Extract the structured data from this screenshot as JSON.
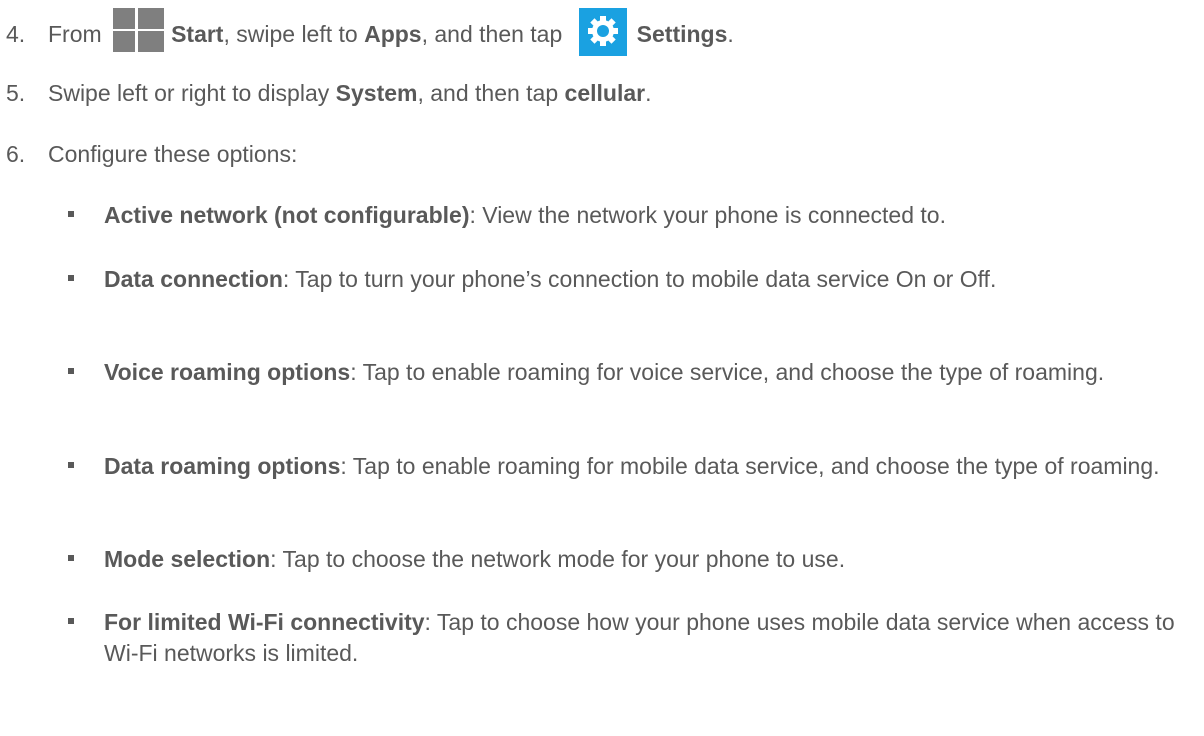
{
  "steps": [
    {
      "number": "4.",
      "p1": "From",
      "p2": "Start",
      "p3": ", swipe left to ",
      "p4": "Apps",
      "p5": ", and then tap",
      "p6": "Settings",
      "p7": "."
    },
    {
      "number": "5.",
      "p1": "Swipe left or right to display ",
      "p2": "System",
      "p3": ", and then tap ",
      "p4": "cellular",
      "p5": "."
    },
    {
      "number": "6.",
      "p1": "Configure these options:"
    }
  ],
  "options": [
    {
      "term": "Active network (not configurable)",
      "desc": ": View the network your phone is connected to."
    },
    {
      "term": "Data connection",
      "desc": ": Tap to turn your phone’s connection to mobile data service On or Off."
    },
    {
      "term": "Voice roaming options",
      "desc": ": Tap to enable roaming for voice service, and choose the type of roaming."
    },
    {
      "term": "Data roaming options",
      "desc": ": Tap to enable roaming for mobile data service, and choose the type of roaming."
    },
    {
      "term": "Mode selection",
      "desc": ": Tap to choose the network mode for your phone to use."
    },
    {
      "term": "For limited Wi-Fi connectivity",
      "desc": ": Tap to choose how your phone uses mobile data service when access to Wi-Fi networks is limited."
    }
  ],
  "icons": {
    "start": "windows-start-icon",
    "settings": "settings-gear-icon"
  },
  "colors": {
    "text": "#595959",
    "settings_tile": "#1aa1e1",
    "start_tile": "#7f7f7f"
  }
}
